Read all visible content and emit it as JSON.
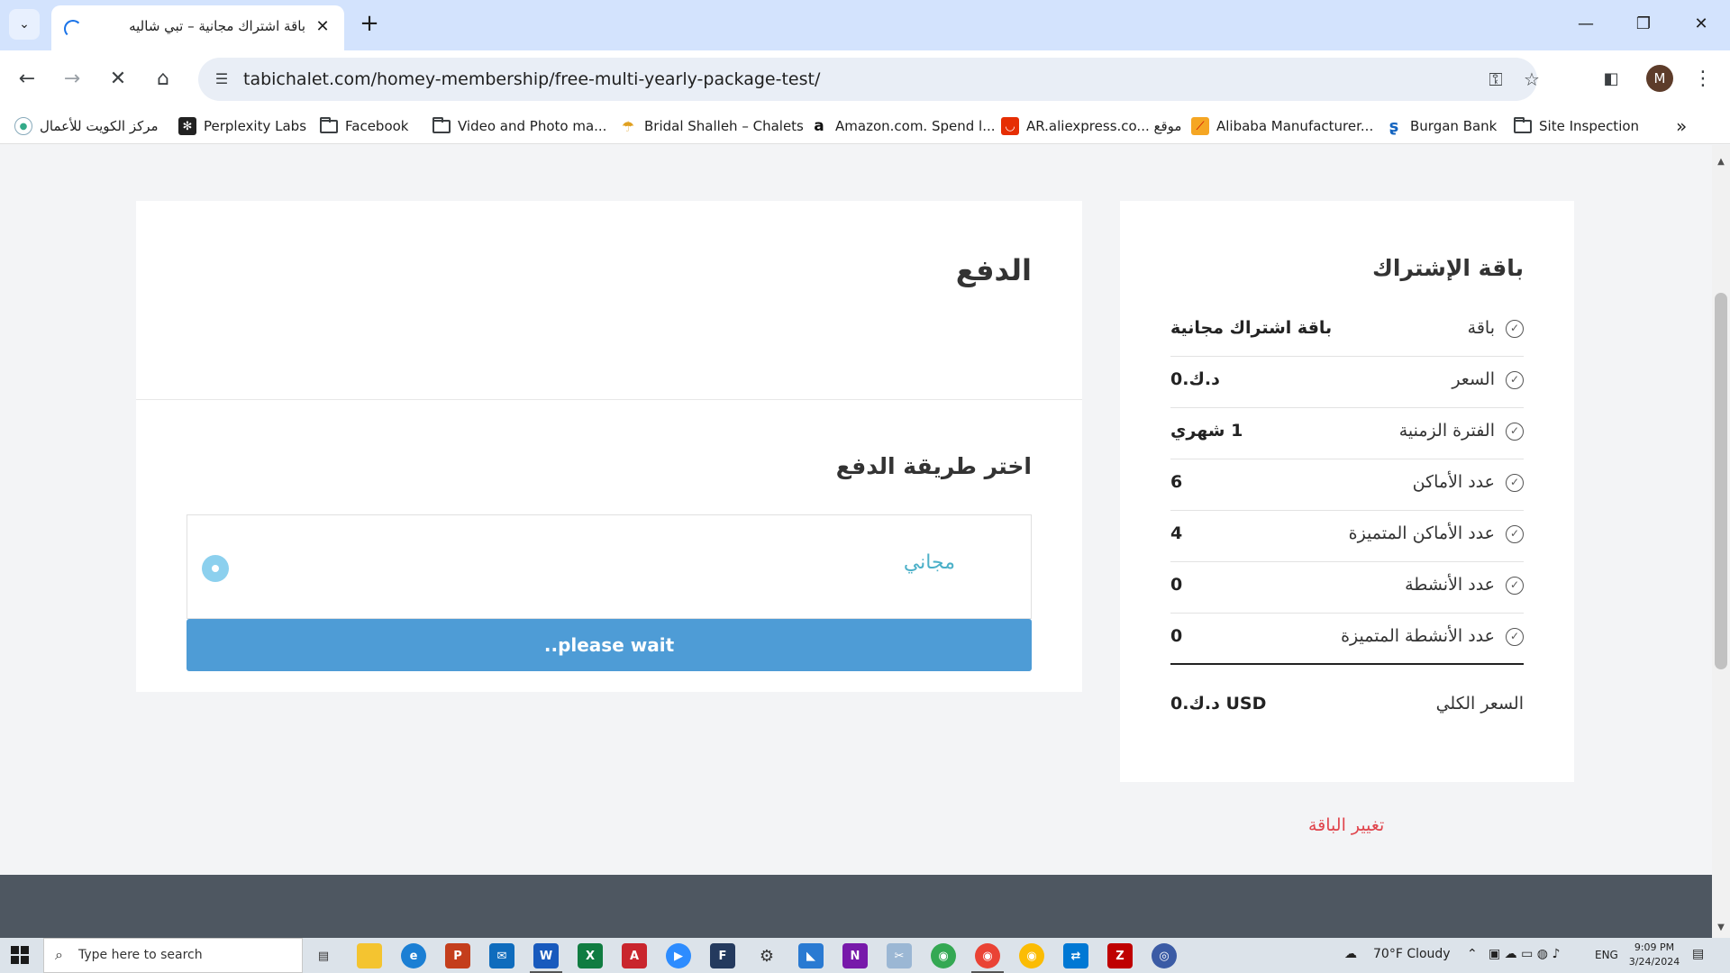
{
  "browser": {
    "tab_title": "باقة اشتراك مجانية – تبي شاليه",
    "url": "tabichalet.com/homey-membership/free-multi-yearly-package-test/",
    "profile_initial": "M"
  },
  "bookmarks": [
    {
      "label": "مركز الكويت للأعمال",
      "icon": "kuwait-center-icon"
    },
    {
      "label": "Perplexity Labs",
      "icon": "perplexity-icon"
    },
    {
      "label": "Facebook",
      "icon": "folder-icon"
    },
    {
      "label": "Video and Photo ma...",
      "icon": "folder-icon"
    },
    {
      "label": "Bridal Shalleh – Chalets",
      "icon": "umbrella-icon"
    },
    {
      "label": "Amazon.com. Spend l...",
      "icon": "amazon-icon"
    },
    {
      "label": "AR.aliexpress.co... موقع",
      "icon": "aliexpress-icon"
    },
    {
      "label": "Alibaba Manufacturer...",
      "icon": "alibaba-icon"
    },
    {
      "label": "Burgan Bank",
      "icon": "burgan-icon"
    },
    {
      "label": "Site Inspection",
      "icon": "folder-icon"
    }
  ],
  "payment": {
    "title": "الدفع",
    "subtitle": "اختر طريقة الدفع",
    "method_label": "مجاني",
    "button_label": "..please wait"
  },
  "package": {
    "title": "باقة الإشتراك",
    "rows": [
      {
        "label": "باقة",
        "value": "باقة اشتراك مجانية"
      },
      {
        "label": "السعر",
        "value": "د.ك.0"
      },
      {
        "label": "الفترة الزمنية",
        "value": "1 شهري"
      },
      {
        "label": "عدد الأماكن",
        "value": "6"
      },
      {
        "label": "عدد الأماكن المتميزة",
        "value": "4"
      },
      {
        "label": "عدد الأنشطة",
        "value": "0"
      },
      {
        "label": "عدد الأنشطة المتميزة",
        "value": "0"
      }
    ],
    "total_label": "السعر الكلي",
    "total_value": "د.ك.0 USD",
    "change_label": "تغيير الباقة"
  },
  "taskbar": {
    "search_placeholder": "Type here to search",
    "weather": "70°F  Cloudy",
    "language": "ENG",
    "time": "9:09 PM",
    "date": "3/24/2024"
  },
  "colors": {
    "accent_button": "#4e9cd6",
    "method_text": "#4cb0c8",
    "change_link": "#e0454d",
    "footer": "#4e5761"
  }
}
